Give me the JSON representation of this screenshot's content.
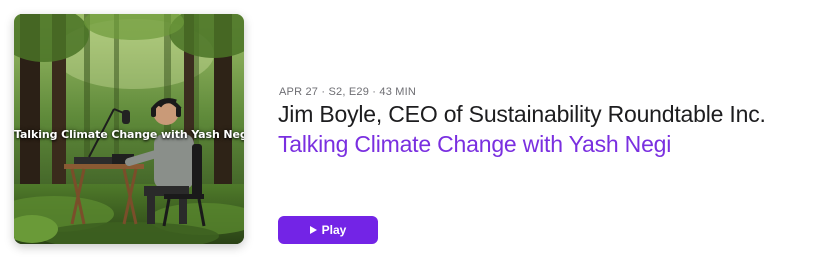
{
  "episode": {
    "meta": "APR 27 · S2, E29 · 43 MIN",
    "title": "Jim Boyle, CEO of Sustainability Roundtable Inc.",
    "show_name": "Talking Climate Change with Yash Negi",
    "artwork_caption": "Talking Climate Change with Yash Negi",
    "play_label": "Play",
    "play_icon": "play-triangle-icon"
  },
  "colors": {
    "accent": "#7324e6",
    "show_link": "#7a2fe0",
    "meta_gray": "#6e6e73",
    "title": "#1d1d1f"
  }
}
